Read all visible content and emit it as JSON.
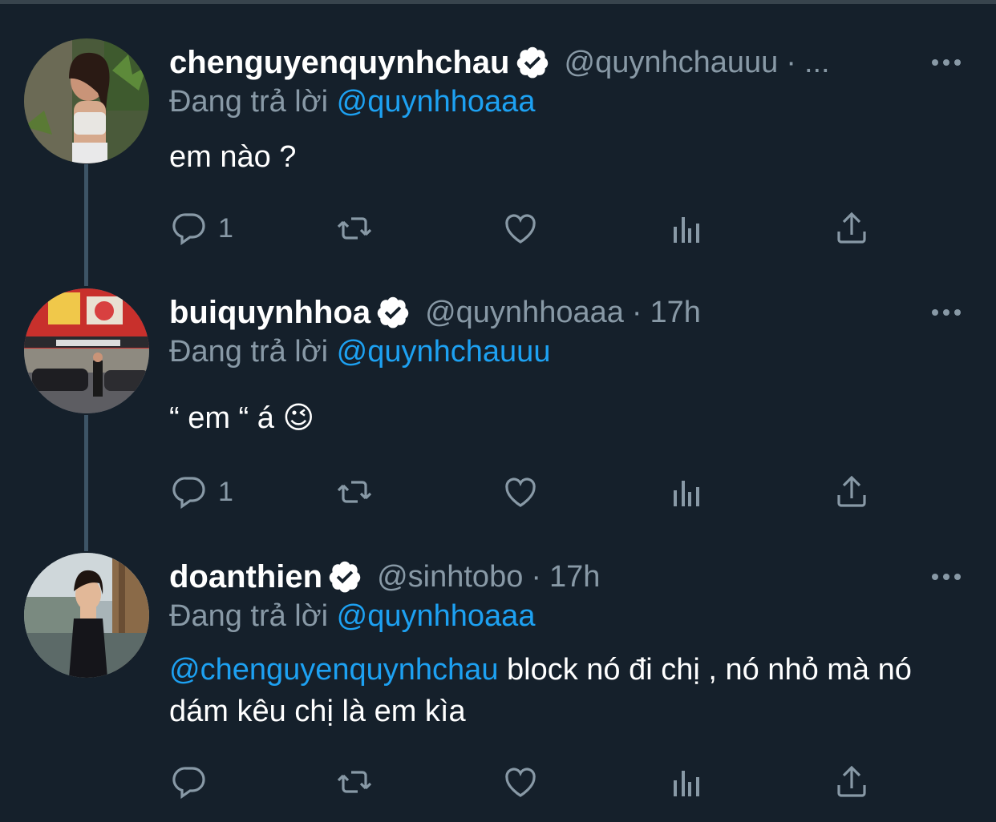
{
  "colors": {
    "background": "#15202b",
    "text_primary": "#ffffff",
    "text_secondary": "#8899a6",
    "accent": "#1da1f2",
    "thread_line": "#3d5466"
  },
  "tweets": [
    {
      "display_name": "chenguyenquynhchau",
      "handle": "@quynhchauuu",
      "dot": "·",
      "time": "...",
      "replying_prefix": "Đang trả lời",
      "replying_to": "@quynhhoaaa",
      "text": "em nào ?",
      "reply_count": "1",
      "verified": true,
      "avatar_icon": "avatar-photo-woman-plants"
    },
    {
      "display_name": "buiquynhhoa",
      "handle": "@quynhhoaaa",
      "dot": "·",
      "time": "17h",
      "replying_prefix": "Đang trả lời",
      "replying_to": "@quynhchauuu",
      "text": "“ em “ á 😉",
      "reply_count": "1",
      "verified": true,
      "avatar_icon": "avatar-photo-street-ramen"
    },
    {
      "display_name": "doanthien",
      "handle": "@sinhtobo",
      "dot": "·",
      "time": "17h",
      "replying_prefix": "Đang trả lời",
      "replying_to": "@quynhhoaaa",
      "text_mention": "@chenguyenquynhchau",
      "text": " block nó đi chị , nó nhỏ mà nó dám kêu chị là em kìa",
      "reply_count": "",
      "verified": true,
      "avatar_icon": "avatar-photo-woman-city"
    }
  ],
  "icons": {
    "reply": "reply-icon",
    "retweet": "retweet-icon",
    "like": "heart-icon",
    "analytics": "analytics-icon",
    "share": "share-icon",
    "more": "more-icon",
    "verified": "verified-badge-icon"
  }
}
